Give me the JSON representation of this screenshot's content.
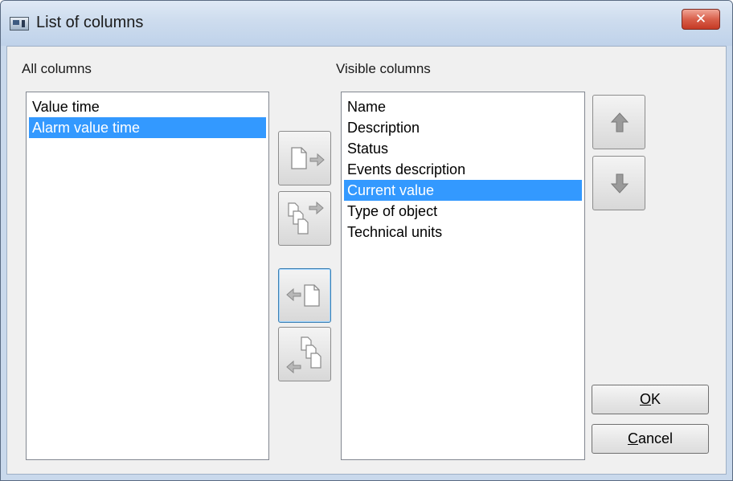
{
  "window": {
    "title": "List of columns",
    "close_label": "✕"
  },
  "left_panel": {
    "label": "All columns",
    "items": [
      "Value time",
      "Alarm value time"
    ],
    "selected_index": 1
  },
  "right_panel": {
    "label": "Visible columns",
    "items": [
      "Name",
      "Description",
      "Status",
      "Events description",
      "Current value",
      "Type of object",
      "Technical units"
    ],
    "selected_index": 4
  },
  "transfer_buttons": [
    {
      "icon": "add-one-icon"
    },
    {
      "icon": "add-all-icon"
    },
    {
      "icon": "remove-one-icon"
    },
    {
      "icon": "remove-all-icon"
    }
  ],
  "order_buttons": [
    {
      "icon": "arrow-up-icon"
    },
    {
      "icon": "arrow-down-icon"
    }
  ],
  "dialog_buttons": {
    "ok": {
      "first": "O",
      "rest": "K"
    },
    "cancel": {
      "first": "C",
      "rest": "ancel"
    }
  },
  "colors": {
    "selection": "#3399ff",
    "close_button": "#d9604b"
  }
}
